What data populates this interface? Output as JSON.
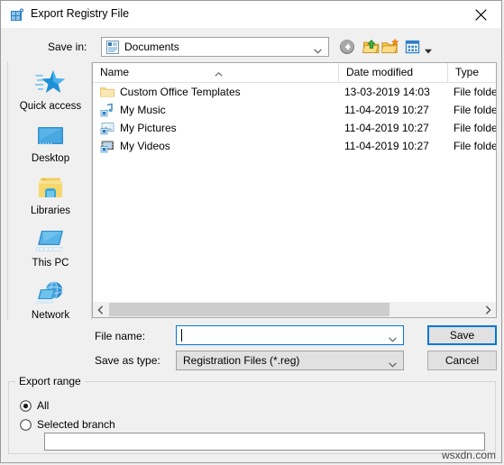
{
  "window": {
    "title": "Export Registry File",
    "icon": "registry-editor-icon",
    "close_label": "✕"
  },
  "savein": {
    "label": "Save in:",
    "value": "Documents",
    "icon": "documents-folder-icon",
    "chevron": "chevron-down-icon"
  },
  "toolbar": {
    "items": [
      {
        "name": "back-button",
        "icon": "back-arrow-icon",
        "tooltip": "Back"
      },
      {
        "name": "up-one-level-button",
        "icon": "up-folder-icon",
        "tooltip": "Up one level"
      },
      {
        "name": "new-folder-button",
        "icon": "new-folder-icon",
        "tooltip": "Create New Folder"
      },
      {
        "name": "views-button",
        "icon": "views-icon",
        "tooltip": "Views"
      }
    ]
  },
  "places": [
    {
      "label": "Quick access",
      "icon": "quick-access-star-icon"
    },
    {
      "label": "Desktop",
      "icon": "desktop-monitor-icon"
    },
    {
      "label": "Libraries",
      "icon": "libraries-folder-icon"
    },
    {
      "label": "This PC",
      "icon": "this-pc-icon"
    },
    {
      "label": "Network",
      "icon": "network-globe-icon"
    }
  ],
  "file_list": {
    "columns": [
      "Name",
      "Date modified",
      "Type"
    ],
    "sort_column": "Name",
    "sort_direction": "ascending",
    "rows": [
      {
        "name": "Custom Office Templates",
        "date_modified": "13-03-2019 14:03",
        "type": "File folder",
        "icon": "folder-icon"
      },
      {
        "name": "My Music",
        "date_modified": "11-04-2019 10:27",
        "type": "File folder",
        "icon": "music-folder-icon"
      },
      {
        "name": "My Pictures",
        "date_modified": "11-04-2019 10:27",
        "type": "File folder",
        "icon": "pictures-folder-icon"
      },
      {
        "name": "My Videos",
        "date_modified": "11-04-2019 10:27",
        "type": "File folder",
        "icon": "videos-folder-icon"
      }
    ]
  },
  "scrollbar": {
    "left_arrow": "‹",
    "right_arrow": "›"
  },
  "form": {
    "filename_label": "File name:",
    "filename_value": "",
    "filename_placeholder": "",
    "savetype_label": "Save as type:",
    "savetype_value": "Registration Files (*.reg)",
    "save_label": "Save",
    "cancel_label": "Cancel"
  },
  "export_range": {
    "legend": "Export range",
    "options": [
      {
        "label": "All",
        "selected": true
      },
      {
        "label": "Selected branch",
        "selected": false
      }
    ],
    "branch_value": ""
  },
  "watermark": "wsxdn.com",
  "colors": {
    "accent": "#0078d7",
    "window_bg": "#f0f0f0",
    "field_bg": "#ffffff",
    "button_bg": "#e1e1e1",
    "border": "#a0a0a0",
    "folder_yellow": "#ffd966"
  }
}
